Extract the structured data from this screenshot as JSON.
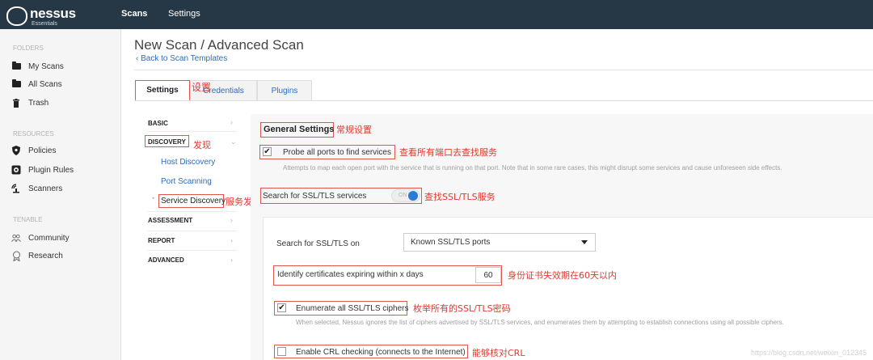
{
  "topbar": {
    "logo_text": "nessus",
    "logo_sub": "Essentials",
    "nav_scans": "Scans",
    "nav_settings": "Settings"
  },
  "sidebar": {
    "folders_heading": "FOLDERS",
    "folders": [
      "My Scans",
      "All Scans",
      "Trash"
    ],
    "resources_heading": "RESOURCES",
    "resources": [
      "Policies",
      "Plugin Rules",
      "Scanners"
    ],
    "tenable_heading": "TENABLE",
    "tenable": [
      "Community",
      "Research"
    ]
  },
  "header": {
    "title": "New Scan / Advanced Scan",
    "back_link": "Back to Scan Templates"
  },
  "tabs": {
    "settings": "Settings",
    "credentials": "Credentials",
    "plugins": "Plugins"
  },
  "menu": {
    "basic": "BASIC",
    "discovery": "DISCOVERY",
    "host_discovery": "Host Discovery",
    "port_scanning": "Port Scanning",
    "service_discovery": "Service Discovery",
    "assessment": "ASSESSMENT",
    "report": "REPORT",
    "advanced": "ADVANCED"
  },
  "content": {
    "general_settings": "General Settings",
    "probe_label": "Probe all ports to find services",
    "probe_checked": true,
    "probe_desc": "Attempts to map each open port with the service that is running on that port. Note that in some rare cases, this might disrupt some services and cause unforeseen side effects.",
    "ssl_label": "Search for SSL/TLS services",
    "ssl_toggle": "ON",
    "ssl_on_label": "Search for SSL/TLS on",
    "ssl_on_value": "Known SSL/TLS ports",
    "cert_label": "Identify certificates expiring within x days",
    "cert_value": "60",
    "enum_label": "Enumerate all SSL/TLS ciphers",
    "enum_checked": true,
    "enum_desc": "When selected, Nessus ignores the list of ciphers advertised by SSL/TLS services, and enumerates them by attempting to establish connections using all possible ciphers.",
    "crl_label": "Enable CRL checking (connects to the Internet)",
    "crl_checked": false
  },
  "annotations": {
    "settings": "设置",
    "discovery": "发现",
    "service_discovery": "服务发现",
    "general": "常规设置",
    "probe": "查看所有端口去查找服务",
    "ssl": "查找SSL/TLS服务",
    "cert": "身份证书失效期在60天以内",
    "enum": "枚举所有的SSL/TLS密码",
    "crl": "能够核对CRL"
  },
  "watermark": "https://blog.csdn.net/weixin_012345"
}
